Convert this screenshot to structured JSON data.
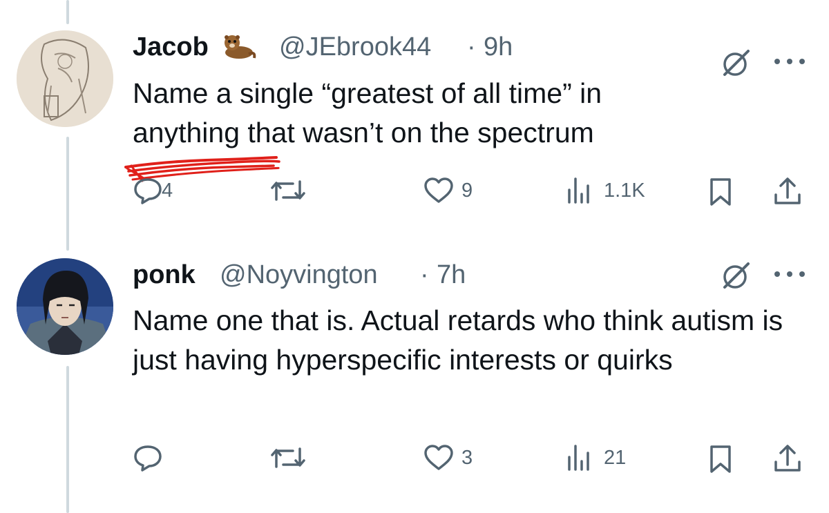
{
  "colors": {
    "text": "#0f1419",
    "muted": "#536471",
    "thread": "#cfd9de",
    "annotation": "#e0201a"
  },
  "tweets": [
    {
      "display_name": "Jacob",
      "emoji_icon": "otter-emoji-icon",
      "handle": "@JEbrook44",
      "separator": "·",
      "time": "9h",
      "text": "Name a single “greatest of all time” in anything that wasn’t on the spectrum",
      "replies": "4",
      "retweets": "",
      "likes": "9",
      "views": "1.1K"
    },
    {
      "display_name": "ponk",
      "handle": "@Noyvington",
      "separator": "·",
      "time": "7h",
      "text": "Name one that is. Actual retards who think autism is just having hyperspecific interests or quirks",
      "replies": "",
      "retweets": "",
      "likes": "3",
      "views": "21"
    }
  ]
}
